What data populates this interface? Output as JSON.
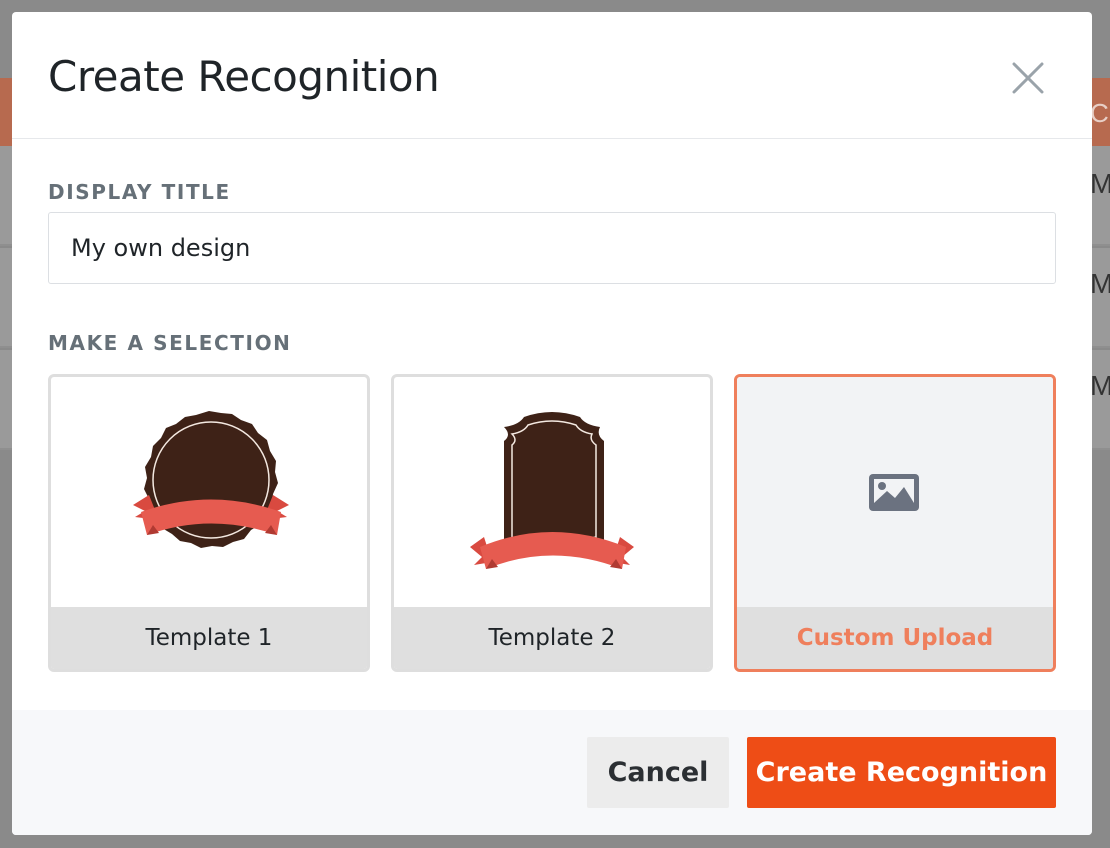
{
  "background": {
    "header_text": "Cr",
    "row_texts": [
      "M",
      "M",
      "M"
    ]
  },
  "modal": {
    "title": "Create Recognition",
    "close_icon": "close-icon"
  },
  "form": {
    "display_title_label": "DISPLAY TITLE",
    "display_title_value": "My own design",
    "selection_label": "MAKE A SELECTION"
  },
  "options": [
    {
      "label": "Template 1",
      "icon": "seal-badge-icon",
      "selected": false
    },
    {
      "label": "Template 2",
      "icon": "shield-badge-icon",
      "selected": false
    },
    {
      "label": "Custom Upload",
      "icon": "image-icon",
      "selected": true
    }
  ],
  "footer": {
    "cancel_label": "Cancel",
    "create_label": "Create Recognition"
  },
  "colors": {
    "accent": "#ee4d16",
    "selected_border": "#ef7f5c",
    "badge_brown": "#3e2217",
    "ribbon_red": "#e65b50"
  }
}
